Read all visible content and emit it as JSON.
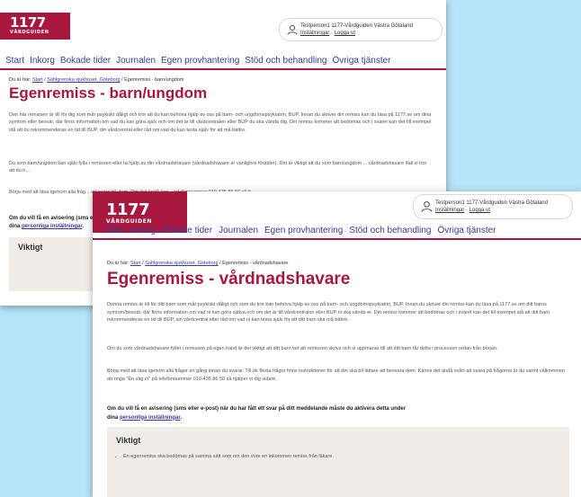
{
  "back": {
    "logo_num": "1177",
    "logo_brand": "VÅRDGUIDEN",
    "user_line1": "Testperson1 1177-Vårdguiden Västra Götaland",
    "user_settings": "Inställningar",
    "user_sep": " · ",
    "user_logout": "Logga ut",
    "nav": [
      "Start",
      "Inkorg",
      "Bokade tider",
      "Journalen",
      "Egen provhantering",
      "Stöd och behandling",
      "Övriga tjänster"
    ],
    "crumb_prefix": "Du är här: ",
    "crumb_start": "Start",
    "crumb_hospital": "Sahlgrenska sjukhuset, Göteborg",
    "crumb_current": " / Egenremiss - barn/ungdom",
    "title": "Egenremiss - barn/ungdom",
    "p1": "Den här remissen är till för dig som mår psykiskt dåligt och tror att du kan behöva hjälp av oss på barn- och ungdomspsykiatrin, BUP. Innan du skriver din remiss kan du läsa på 1177.se om dina symtom eller besvär, där finns information om vad du kan göra själv och om det är till vårdcentralen eller BUP du ska vända dig. Din remiss kommer att bedömas och i svaret kan det till exempel stå att du rekommenderas en tid till BUP, din vårdcentral eller råd om vad du kan testa själv för att må bättre.",
    "p2": "Du som barn/ungdom kan själv fylla i remissen eller ta hjälp av din vårdnadshavare (vårdnadshavare är vanligtvis förälder). Det är viktigt att du som barn/ungdom ... vårdnadshavare ifall vi tror att du h...",
    "p3": "Börja med att läsa igenom alla fråg... att svara på dem. Om det ändå kan... telefonnummer 010-435 86 50 så h...",
    "b1_start": "Om du vill få en avisering (sms el...",
    "b1_prefix": "dina ",
    "b1_link": "personliga inställningar",
    "viktig": "Viktigt"
  },
  "front": {
    "logo_num": "1177",
    "logo_brand": "VÅRDGUIDEN",
    "user_line1": "Testperson1 1177-Vårdguiden Västra Götaland",
    "user_settings": "Inställningar",
    "user_sep": " · ",
    "user_logout": "Logga ut",
    "nav": [
      "Start",
      "Inkorg",
      "Bokade tider",
      "Journalen",
      "Egen provhantering",
      "Stöd och behandling",
      "Övriga tjänster"
    ],
    "crumb_prefix": "Du är här: ",
    "crumb_start": "Start",
    "crumb_hospital": "Sahlgrenska sjukhuset, Göteborg",
    "crumb_current": " / Egenremiss - vårdnadshavare",
    "title": "Egenremiss - vårdnadshavare",
    "p1": "Denna remiss är till för ditt barn som mår psykiskt dåligt och som du tror kan behöva hjälp av oss på barn- och ungdomspsykiatrin, BUP. Innan du skriver din remiss kan du läsa på 1177.se om ditt barns symtom/besvär, där finns information om vad ni kan göra själva och om det är till vårdcentralen eller BUP ni ska vända er. Din remiss kommer att bedömas och i svaret kan det till exempel stå att ditt barn rekommenderas en tid till BUP, sin vårdcentral eller råd om vad ni kan testa själv för att ditt barn ska må bättre.",
    "p2": "Om du som vårdnadshavare fyller i remissen på egen hand är det viktigt att ditt barn vet att remissen skrivs och vi uppmanar till att ditt barn får delta i processen redan från början.",
    "p3": "Börja med att läsa igenom alla frågor en gång innan du svarar. Till de flesta frågor finns instruktioner för att det ska bli lättare att besvara dem. Känns det ändå svårt att svara på frågorna är du varmt välkommen att ringa \"En väg in\" på telefonnummer 010-435 86 50 så hjälper vi dig vidare.",
    "b1_start": "Om du vill få en avisering (sms eller e-post) när du har fått ett svar på ditt meddelande måste du aktivera detta under",
    "b1_prefix": "dina ",
    "b1_link": "personliga inställningar",
    "viktig": "Viktigt",
    "viktig_items": [
      "En egenremiss ska bedömas på samma sätt som om den vore en inkommen remiss från läkare."
    ]
  },
  "colors": {
    "brand": "#a8183e",
    "link": "#3a3a9a",
    "background": "#b7e4f8"
  }
}
